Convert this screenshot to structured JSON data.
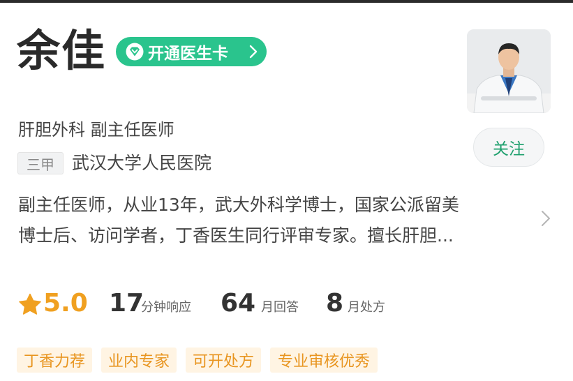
{
  "doctor": {
    "name": "余佳",
    "vip_card_label": "开通医生卡",
    "department_title": "肝胆外科 副主任医师",
    "hospital_level": "三甲",
    "hospital": "武汉大学人民医院",
    "follow_label": "关注",
    "intro_lines": [
      "副主任医师，从业13年，武大外科学博士，国家公派留美",
      "博士后、访问学者，丁香医生同行评审专家。擅长肝胆..."
    ]
  },
  "stats": {
    "rating": "5.0",
    "response_num": "17",
    "response_unit": "分钟响应",
    "answers_num": "64",
    "answers_unit": "月回答",
    "rx_num": "8",
    "rx_unit": "月处方"
  },
  "tags": [
    "丁香力荐",
    "业内专家",
    "可开处方",
    "专业审核优秀"
  ],
  "colors": {
    "accent_green": "#2ac48d",
    "follow_green": "#1fa06e",
    "rating_orange": "#f0a020",
    "tag_bg": "#fff4e3",
    "tag_text": "#e89520"
  },
  "icons": [
    "diamond-icon",
    "chevron-right-icon",
    "star-icon",
    "doctor-avatar"
  ]
}
